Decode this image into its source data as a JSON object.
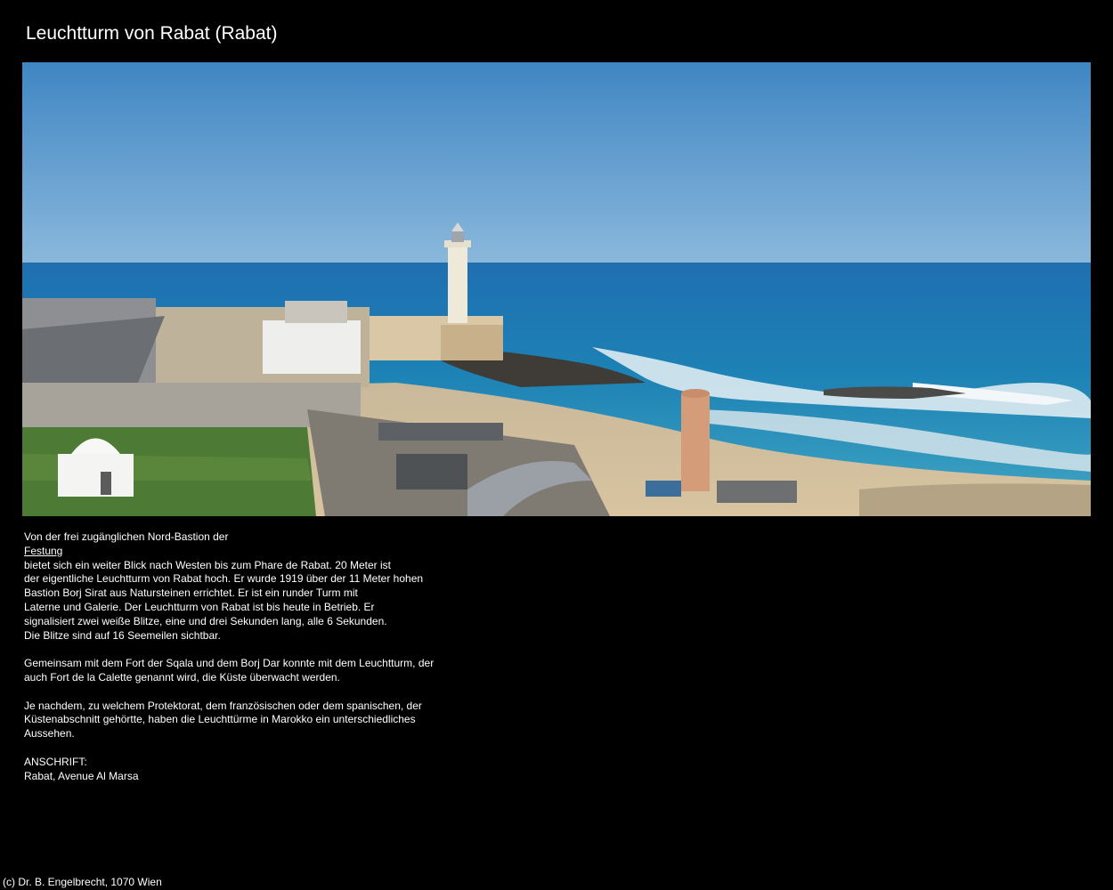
{
  "page": {
    "title": "Leuchtturm von Rabat (Rabat)"
  },
  "description": {
    "intro": "Von der frei zugänglichen Nord-Bastion der",
    "link_label": "Festung",
    "line1": "bietet sich ein weiter Blick nach Westen bis zum Phare de Rabat. 20 Meter ist",
    "line2": "der eigentliche Leuchtturm von Rabat hoch. Er wurde 1919 über der 11 Meter hohen",
    "line3": "Bastion Borj Sirat aus Natursteinen errichtet. Er ist ein runder Turm mit",
    "line4": "Laterne und Galerie. Der Leuchtturm von Rabat ist bis heute in Betrieb. Er",
    "line5": "signalisiert zwei weiße Blitze, eine und drei Sekunden lang, alle 6 Sekunden.",
    "line6": "Die Blitze sind auf 16 Seemeilen sichtbar.",
    "para2_line1": "Gemeinsam mit dem Fort der Sqala und dem Borj Dar konnte mit dem Leuchtturm, der",
    "para2_line2": "auch Fort de la Calette genannt wird, die Küste überwacht werden.",
    "para3_line1": "Je nachdem, zu welchem Protektorat, dem französischen oder dem spanischen, der",
    "para3_line2": "Küstenabschnitt gehörtte, haben die Leuchttürme in Marokko ein unterschiedliches",
    "para3_line3": "Aussehen."
  },
  "address": {
    "label": "ANSCHRIFT:",
    "value": "Rabat, Avenue Al Marsa"
  },
  "footer": {
    "copyright": "(c) Dr. B. Engelbrecht, 1070 Wien"
  },
  "colors": {
    "background": "#000000",
    "text": "#ffffff"
  }
}
